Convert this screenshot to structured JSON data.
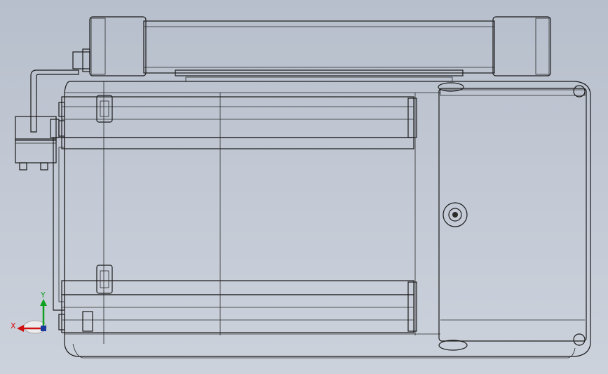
{
  "triad": {
    "x_label": "X",
    "y_label": "Y",
    "x_color": "#d01010",
    "y_color": "#10a020"
  },
  "colors": {
    "background": "#c2c8d3",
    "body": "#c4c4b4",
    "body_dark": "#8e8e7e",
    "edge": "#1a1a1a"
  }
}
